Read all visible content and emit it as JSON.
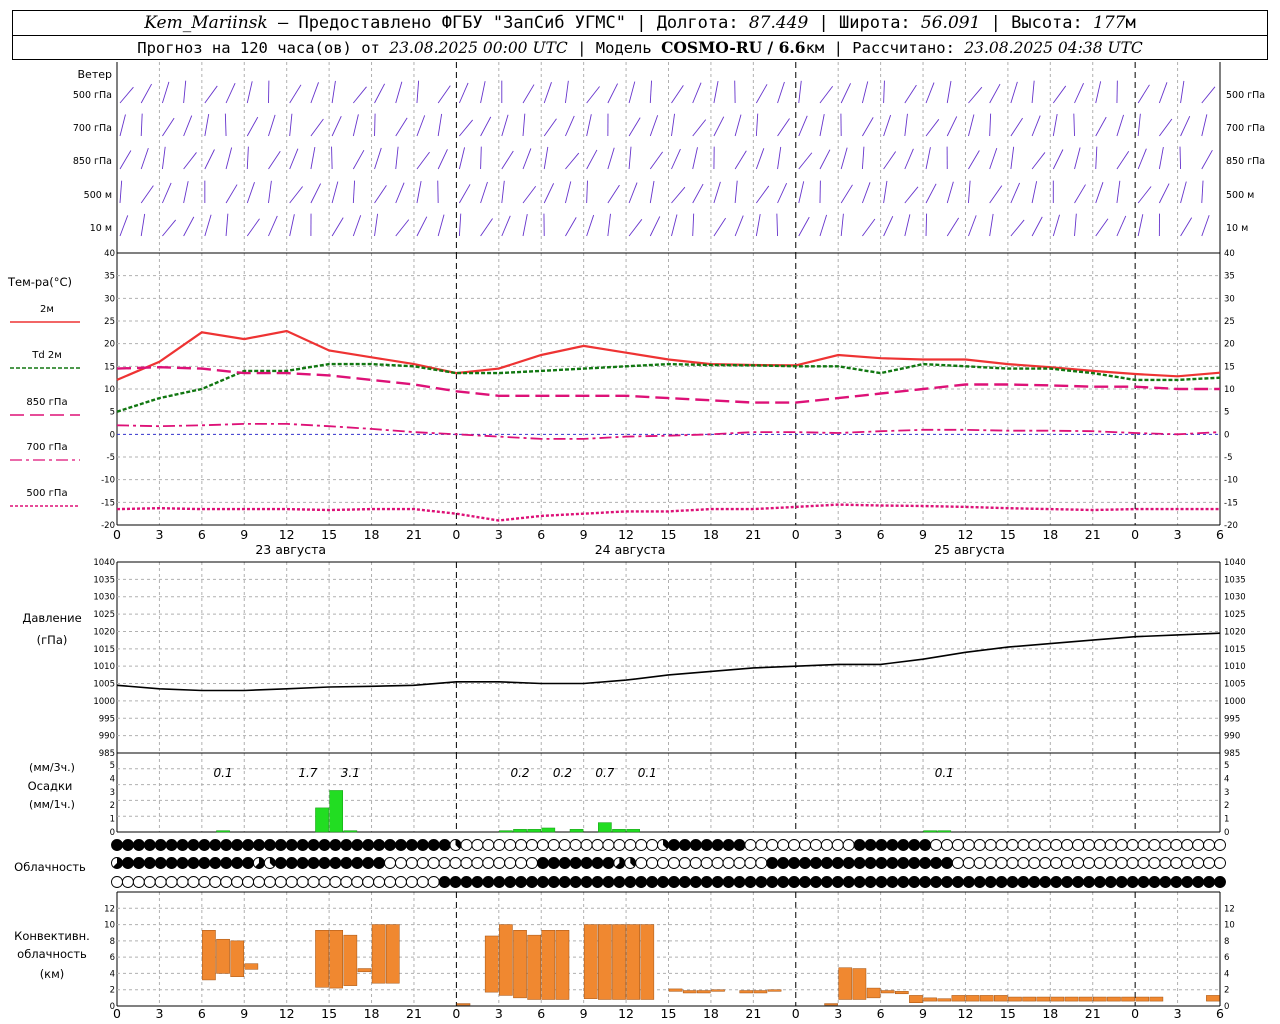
{
  "header": {
    "station": "Kem_Mariinsk",
    "dash": " – ",
    "provider": "Предоставлено ФГБУ \"ЗапСиб УГМС\"",
    "sep": " | ",
    "lon_label": "Долгота: ",
    "lon_value": "87.449",
    "lat_label": "Широта: ",
    "lat_value": "56.091",
    "alt_label": "Высота: ",
    "alt_value": "177",
    "alt_unit": "м",
    "forecast_prefix": "Прогноз на 120 часа(ов) от ",
    "forecast_date": "23.08.2025 00:00 UTC",
    "model_label": "Модель ",
    "model_name": "COSMO-RU / 6.6",
    "model_unit": "км",
    "calc_label": "Рассчитано: ",
    "calc_date": "23.08.2025 04:38 UTC"
  },
  "colors": {
    "t2m": "#ee3333",
    "td2m": "#117711",
    "t850": "#dd1177",
    "t700": "#dd1177",
    "t500": "#dd1177",
    "pressure": "#000000",
    "precip": "#22dd22",
    "convective": "#f08830",
    "wind": "#6633cc",
    "zero_line": "#3333cc",
    "grid": "#b0b0b0",
    "midnight": "#000000"
  },
  "x_axis": {
    "hour_ticks": [
      "0",
      "3",
      "6",
      "9",
      "12",
      "15",
      "18",
      "21",
      "0",
      "3",
      "6",
      "9",
      "12",
      "15",
      "18",
      "21",
      "0",
      "3",
      "6",
      "9",
      "12",
      "15",
      "18",
      "21",
      "0",
      "3",
      "6"
    ],
    "day_labels": [
      "23 августа",
      "24 августа",
      "25 августа"
    ]
  },
  "chart_data": [
    {
      "id": "wind",
      "type": "wind-barbs",
      "title": "Ветер",
      "levels": [
        "500 гПа",
        "700 гПа",
        "850 гПа",
        "500 м",
        "10 м"
      ]
    },
    {
      "id": "temperature",
      "type": "line",
      "title": "Тем-ра(°C)",
      "ylim": [
        -20,
        40
      ],
      "yticks": [
        "40",
        "35",
        "30",
        "25",
        "20",
        "15",
        "10",
        "5",
        "0",
        "-5",
        "-10",
        "-15",
        "-20"
      ],
      "x_hours": [
        0,
        3,
        6,
        9,
        12,
        15,
        18,
        21,
        24,
        27,
        30,
        33,
        36,
        39,
        42,
        45,
        48,
        51,
        54,
        57,
        60,
        63,
        66,
        69,
        72,
        75,
        78
      ],
      "series": [
        {
          "name": "2м",
          "values": [
            12,
            16,
            22.5,
            21,
            22.8,
            18.5,
            17,
            15.5,
            13.5,
            14.5,
            17.5,
            19.5,
            18,
            16.5,
            15.5,
            15.3,
            15.2,
            17.5,
            16.8,
            16.5,
            16.5,
            15.5,
            14.8,
            14,
            13.3,
            12.8,
            13.6
          ]
        },
        {
          "name": "Td 2м",
          "values": [
            5,
            8,
            10,
            14,
            14,
            15.5,
            15.5,
            15,
            13.5,
            13.5,
            14,
            14.5,
            15,
            15.5,
            15.3,
            15.2,
            15,
            15,
            13.5,
            15.5,
            15,
            14.5,
            14.5,
            13.5,
            12,
            12,
            12.5
          ]
        },
        {
          "name": "850 гПа",
          "values": [
            14.5,
            14.8,
            14.5,
            13.5,
            13.5,
            13,
            12,
            11,
            9.5,
            8.5,
            8.5,
            8.5,
            8.5,
            8,
            7.5,
            7,
            7,
            8,
            9,
            10,
            11,
            11,
            10.8,
            10.5,
            10.5,
            10,
            10
          ]
        },
        {
          "name": "700 гПа",
          "values": [
            2,
            1.8,
            2,
            2.3,
            2.3,
            1.8,
            1.2,
            0.5,
            0,
            -0.5,
            -1,
            -1,
            -0.5,
            -0.3,
            0,
            0.5,
            0.5,
            0.3,
            0.7,
            1,
            1,
            0.8,
            0.8,
            0.7,
            0.3,
            0,
            0.5
          ]
        },
        {
          "name": "500 гПа",
          "values": [
            -16.5,
            -16.3,
            -16.5,
            -16.5,
            -16.5,
            -16.7,
            -16.5,
            -16.5,
            -17.5,
            -19,
            -18,
            -17.5,
            -17,
            -17,
            -16.5,
            -16.5,
            -16,
            -15.5,
            -15.7,
            -15.8,
            -16,
            -16.3,
            -16.5,
            -16.7,
            -16.5,
            -16.5,
            -16.5
          ]
        }
      ]
    },
    {
      "id": "pressure",
      "type": "line",
      "title": "Давление",
      "subtitle": "(гПа)",
      "ylim": [
        985,
        1040
      ],
      "yticks": [
        "1040",
        "1035",
        "1030",
        "1025",
        "1020",
        "1015",
        "1010",
        "1005",
        "1000",
        "995",
        "990",
        "985"
      ],
      "x_hours": [
        0,
        3,
        6,
        9,
        12,
        15,
        18,
        21,
        24,
        27,
        30,
        33,
        36,
        39,
        42,
        45,
        48,
        51,
        54,
        57,
        60,
        63,
        66,
        69,
        72,
        75,
        78
      ],
      "series": [
        {
          "name": "",
          "values": [
            1004.5,
            1003.5,
            1003,
            1003,
            1003.5,
            1004,
            1004.2,
            1004.5,
            1005.5,
            1005.5,
            1005,
            1005,
            1006,
            1007.5,
            1008.5,
            1009.5,
            1010,
            1010.5,
            1010.5,
            1012,
            1014,
            1015.5,
            1016.5,
            1017.5,
            1018.5,
            1019,
            1019.5
          ]
        }
      ]
    },
    {
      "id": "precipitation",
      "type": "bar",
      "title": "Осадки",
      "ylabel_top": "(мм/3ч.)",
      "ylabel_bottom": "(мм/1ч.)",
      "ylim": [
        0,
        5
      ],
      "yticks": [
        "5",
        "4",
        "3",
        "2",
        "1",
        "0"
      ],
      "annotations": [
        {
          "hour": 7.5,
          "text": "0.1"
        },
        {
          "hour": 13.5,
          "text": "1.7"
        },
        {
          "hour": 16.5,
          "text": "3.1"
        },
        {
          "hour": 28.5,
          "text": "0.2"
        },
        {
          "hour": 31.5,
          "text": "0.2"
        },
        {
          "hour": 34.5,
          "text": "0.7"
        },
        {
          "hour": 37.5,
          "text": "0.1"
        },
        {
          "hour": 58.5,
          "text": "0.1"
        }
      ],
      "bars": [
        {
          "hour": 7,
          "value": 0.1
        },
        {
          "hour": 14,
          "value": 1.8
        },
        {
          "hour": 15,
          "value": 3.1
        },
        {
          "hour": 16,
          "value": 0.1
        },
        {
          "hour": 27,
          "value": 0.1
        },
        {
          "hour": 28,
          "value": 0.2
        },
        {
          "hour": 29,
          "value": 0.2
        },
        {
          "hour": 30,
          "value": 0.3
        },
        {
          "hour": 32,
          "value": 0.2
        },
        {
          "hour": 34,
          "value": 0.7
        },
        {
          "hour": 35,
          "value": 0.2
        },
        {
          "hour": 36,
          "value": 0.2
        },
        {
          "hour": 57,
          "value": 0.1
        },
        {
          "hour": 58,
          "value": 0.1
        }
      ]
    },
    {
      "id": "cloudiness",
      "type": "table",
      "title": "Облачность",
      "rows": [
        "777777777777777777777777777777731111111111111111113777777711111111117777777111111111111111111111111111",
        "577777777777753777777777711111111111111777777753111111111111777777777777777771111111111111111111111111",
        "111111111111111111111111111111777777777777777777777777777777777777777777777777777777777777777777777777"
      ]
    },
    {
      "id": "convective",
      "type": "bar",
      "title": "Конвективн.",
      "title2": "облачность",
      "title3": "(км)",
      "ylim": [
        0,
        14
      ],
      "yticks": [
        "12",
        "10",
        "8",
        "6",
        "4",
        "2",
        "0"
      ],
      "bars": [
        {
          "hour": 6,
          "base": 3.2,
          "top": 9.3
        },
        {
          "hour": 7,
          "base": 4.0,
          "top": 8.2
        },
        {
          "hour": 8,
          "base": 3.6,
          "top": 8.0
        },
        {
          "hour": 9,
          "base": 4.5,
          "top": 5.2
        },
        {
          "hour": 14,
          "base": 2.3,
          "top": 9.3
        },
        {
          "hour": 15,
          "base": 2.2,
          "top": 9.3
        },
        {
          "hour": 16,
          "base": 2.5,
          "top": 8.7
        },
        {
          "hour": 17,
          "base": 4.2,
          "top": 4.6
        },
        {
          "hour": 18,
          "base": 2.8,
          "top": 10.0
        },
        {
          "hour": 19,
          "base": 2.8,
          "top": 10.0
        },
        {
          "hour": 24,
          "base": 0.2,
          "top": 0.3
        },
        {
          "hour": 26,
          "base": 1.7,
          "top": 8.6
        },
        {
          "hour": 27,
          "base": 1.3,
          "top": 10.0
        },
        {
          "hour": 28,
          "base": 1.0,
          "top": 9.3
        },
        {
          "hour": 29,
          "base": 0.8,
          "top": 8.7
        },
        {
          "hour": 30,
          "base": 0.8,
          "top": 9.3
        },
        {
          "hour": 31,
          "base": 0.8,
          "top": 9.3
        },
        {
          "hour": 33,
          "base": 0.9,
          "top": 10.0
        },
        {
          "hour": 34,
          "base": 0.8,
          "top": 10.0
        },
        {
          "hour": 35,
          "base": 0.8,
          "top": 10.0
        },
        {
          "hour": 36,
          "base": 0.8,
          "top": 10.0
        },
        {
          "hour": 37,
          "base": 0.8,
          "top": 10.0
        },
        {
          "hour": 39,
          "base": 1.8,
          "top": 2.1
        },
        {
          "hour": 40,
          "base": 1.6,
          "top": 1.9
        },
        {
          "hour": 41,
          "base": 1.6,
          "top": 1.9
        },
        {
          "hour": 42,
          "base": 1.8,
          "top": 2.0
        },
        {
          "hour": 44,
          "base": 1.6,
          "top": 1.9
        },
        {
          "hour": 45,
          "base": 1.6,
          "top": 1.9
        },
        {
          "hour": 46,
          "base": 1.8,
          "top": 2.0
        },
        {
          "hour": 50,
          "base": 0.2,
          "top": 0.3
        },
        {
          "hour": 51,
          "base": 0.8,
          "top": 4.7
        },
        {
          "hour": 52,
          "base": 0.8,
          "top": 4.6
        },
        {
          "hour": 53,
          "base": 1.0,
          "top": 2.2
        },
        {
          "hour": 54,
          "base": 1.6,
          "top": 1.9
        },
        {
          "hour": 55,
          "base": 1.5,
          "top": 1.8
        },
        {
          "hour": 56,
          "base": 0.4,
          "top": 1.3
        },
        {
          "hour": 57,
          "base": 0.6,
          "top": 1.0
        },
        {
          "hour": 58,
          "base": 0.6,
          "top": 0.9
        },
        {
          "hour": 59,
          "base": 0.6,
          "top": 1.3
        },
        {
          "hour": 60,
          "base": 0.6,
          "top": 1.3
        },
        {
          "hour": 61,
          "base": 0.6,
          "top": 1.3
        },
        {
          "hour": 62,
          "base": 0.6,
          "top": 1.3
        },
        {
          "hour": 63,
          "base": 0.6,
          "top": 1.1
        },
        {
          "hour": 64,
          "base": 0.6,
          "top": 1.1
        },
        {
          "hour": 65,
          "base": 0.6,
          "top": 1.1
        },
        {
          "hour": 66,
          "base": 0.6,
          "top": 1.1
        },
        {
          "hour": 67,
          "base": 0.6,
          "top": 1.1
        },
        {
          "hour": 68,
          "base": 0.6,
          "top": 1.1
        },
        {
          "hour": 69,
          "base": 0.6,
          "top": 1.1
        },
        {
          "hour": 70,
          "base": 0.6,
          "top": 1.1
        },
        {
          "hour": 71,
          "base": 0.6,
          "top": 1.1
        },
        {
          "hour": 72,
          "base": 0.6,
          "top": 1.1
        },
        {
          "hour": 73,
          "base": 0.6,
          "top": 1.1
        },
        {
          "hour": 77,
          "base": 0.6,
          "top": 1.3
        }
      ]
    }
  ]
}
